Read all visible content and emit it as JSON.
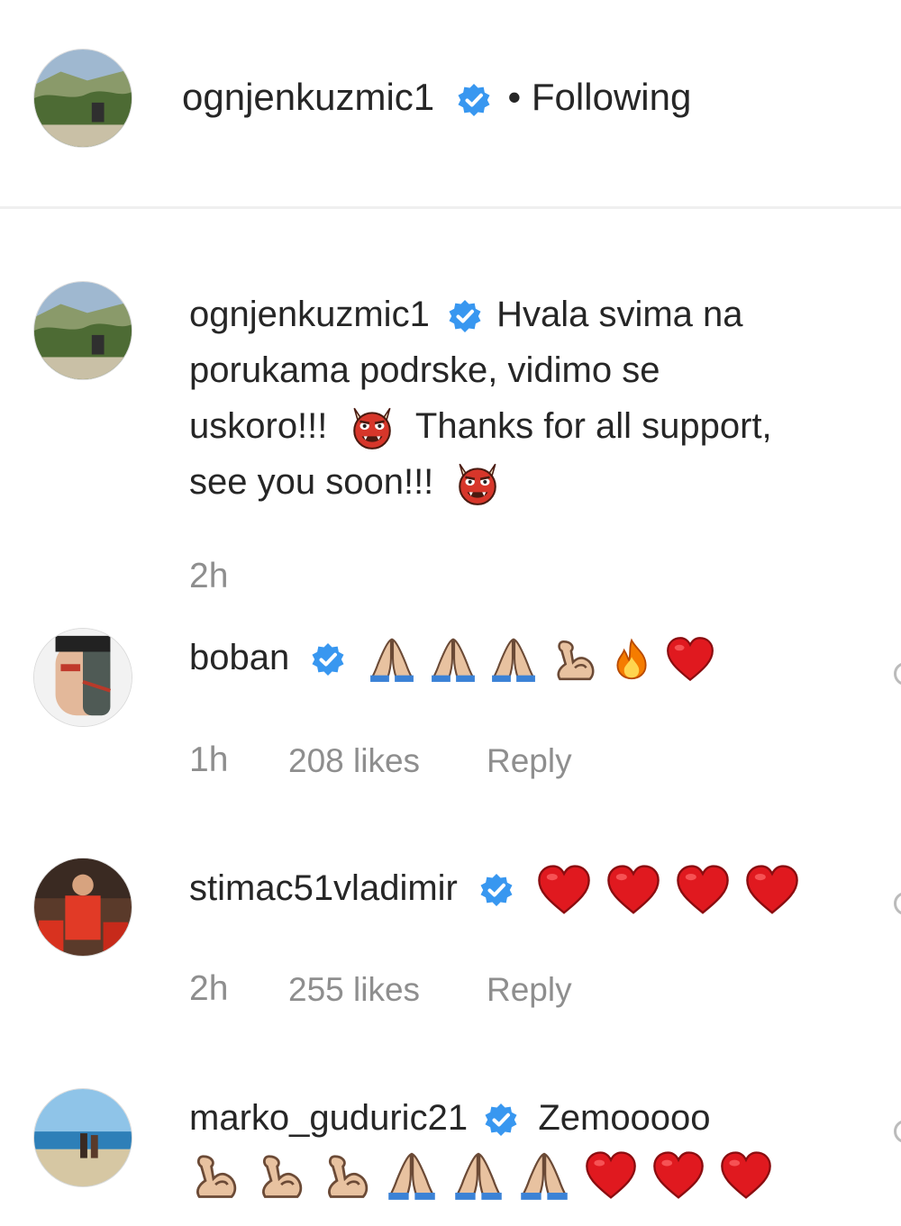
{
  "header": {
    "username": "ognjenkuzmic1",
    "separator": "•",
    "follow_status": "Following"
  },
  "caption": {
    "username": "ognjenkuzmic1",
    "text_line1": "Hvala svima na",
    "text_line2": "porukama podrske, vidimo se",
    "text_line3a": "uskoro!!!",
    "text_line3b": "Thanks for all support,",
    "text_line4": "see you soon!!!",
    "time": "2h"
  },
  "comments": [
    {
      "username": "boban",
      "emojis": [
        "folded-hands-icon",
        "folded-hands-icon",
        "folded-hands-icon",
        "flexed-biceps-icon",
        "fire-icon",
        "red-heart-icon"
      ],
      "time": "1h",
      "likes": "208 likes",
      "reply": "Reply"
    },
    {
      "username": "stimac51vladimir",
      "emojis": [
        "red-heart-icon",
        "red-heart-icon",
        "red-heart-icon",
        "red-heart-icon"
      ],
      "time": "2h",
      "likes": "255 likes",
      "reply": "Reply"
    },
    {
      "username": "marko_guduric21",
      "text": "Zemooooo",
      "emojis": [
        "flexed-biceps-icon",
        "flexed-biceps-icon",
        "flexed-biceps-icon",
        "folded-hands-icon",
        "folded-hands-icon",
        "folded-hands-icon",
        "red-heart-icon",
        "red-heart-icon",
        "red-heart-icon"
      ]
    }
  ],
  "colors": {
    "verified": "#3897f0",
    "text": "#262626",
    "muted": "#8e8e8e",
    "heart": "#e0191f",
    "divider": "#efefef"
  }
}
